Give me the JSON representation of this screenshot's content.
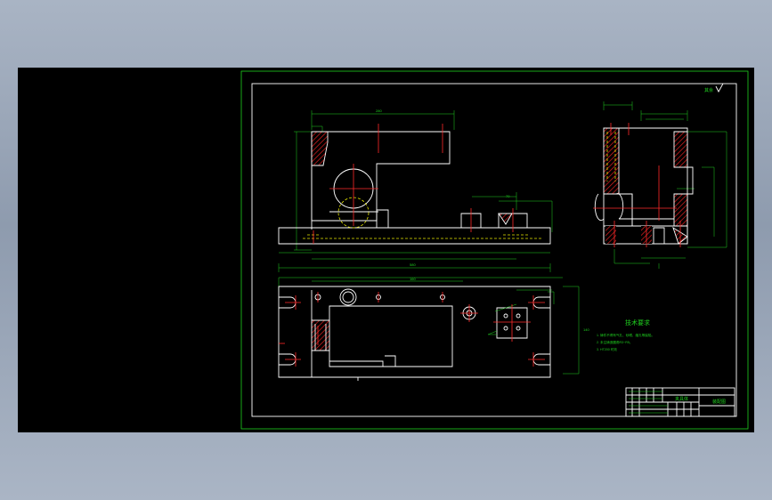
{
  "drawing": {
    "title_block": {
      "part_name": "夹具体",
      "drawing_code": "装配图"
    },
    "tech_requirements": {
      "heading": "技术要求",
      "items": [
        "1. 铸件不得有气孔、砂眼、缩孔等缺陷。",
        "2. 未注铸造圆角R3~R5。",
        "3. HT200 时效"
      ]
    },
    "roughness_mark": "其余"
  },
  "colors": {
    "outline": "#ffffff",
    "dimension": "#1fd11f",
    "centerline": "#ff2a2a",
    "hidden": "#e6e600",
    "canvas": "#000000"
  }
}
